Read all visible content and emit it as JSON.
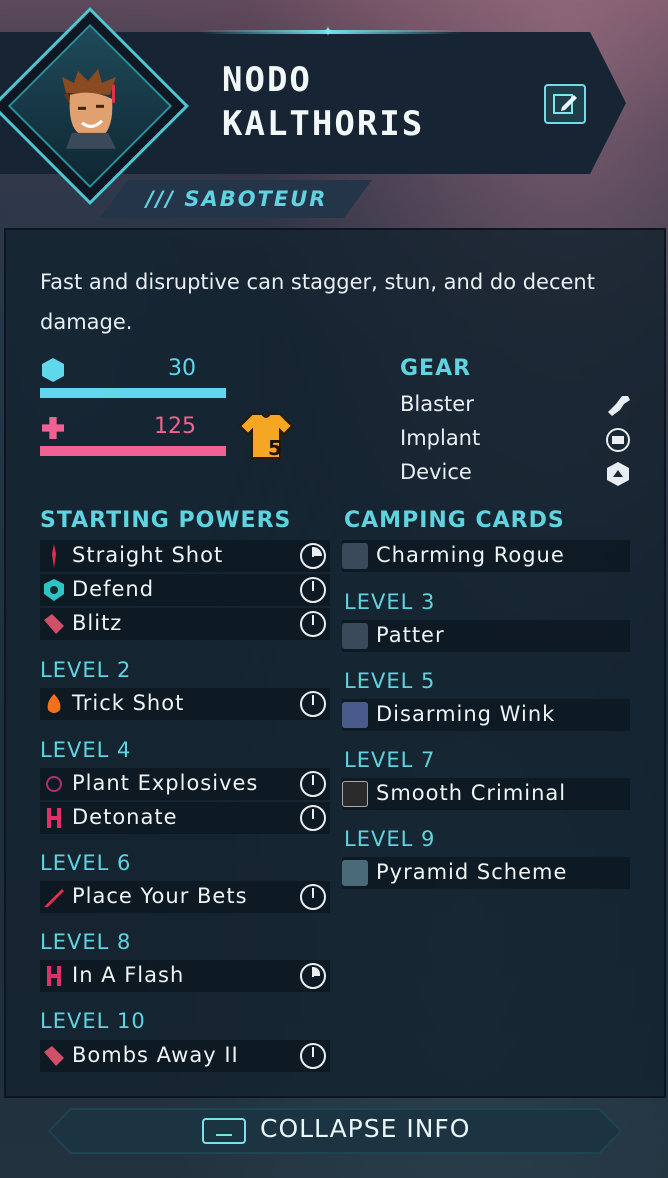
{
  "header": {
    "name_line1": "NODO",
    "name_line2": "KALTHORIS",
    "class": "/// SABOTEUR"
  },
  "description": "Fast and disruptive can stagger, stun, and do decent damage.",
  "stats": {
    "armor": "30",
    "health": "125",
    "badge_level": "5"
  },
  "gear": {
    "title": "GEAR",
    "items": [
      {
        "label": "Blaster",
        "icon": "blaster-icon"
      },
      {
        "label": "Implant",
        "icon": "implant-icon"
      },
      {
        "label": "Device",
        "icon": "device-icon"
      }
    ]
  },
  "powers": {
    "title": "STARTING POWERS",
    "starting": [
      {
        "label": "Straight Shot",
        "icon": "straight-shot-icon",
        "clock": "quarter"
      },
      {
        "label": "Defend",
        "icon": "defend-icon",
        "clock": "full"
      },
      {
        "label": "Blitz",
        "icon": "blitz-icon",
        "clock": "full"
      }
    ],
    "levels": [
      {
        "level": "LEVEL 2",
        "items": [
          {
            "label": "Trick Shot",
            "icon": "trick-shot-icon",
            "clock": "full"
          }
        ]
      },
      {
        "level": "LEVEL 4",
        "items": [
          {
            "label": "Plant Explosives",
            "icon": "plant-explosives-icon",
            "clock": "full"
          },
          {
            "label": "Detonate",
            "icon": "detonate-icon",
            "clock": "full"
          }
        ]
      },
      {
        "level": "LEVEL 6",
        "items": [
          {
            "label": "Place Your Bets",
            "icon": "place-your-bets-icon",
            "clock": "full"
          }
        ]
      },
      {
        "level": "LEVEL 8",
        "items": [
          {
            "label": "In A Flash",
            "icon": "in-a-flash-icon",
            "clock": "eighth"
          }
        ]
      },
      {
        "level": "LEVEL 10",
        "items": [
          {
            "label": "Bombs Away II",
            "icon": "bombs-away-icon",
            "clock": "full"
          }
        ]
      }
    ]
  },
  "camping": {
    "title": "CAMPING CARDS",
    "starting": [
      {
        "label": "Charming Rogue"
      }
    ],
    "levels": [
      {
        "level": "LEVEL 3",
        "label": "Patter"
      },
      {
        "level": "LEVEL 5",
        "label": "Disarming Wink"
      },
      {
        "level": "LEVEL 7",
        "label": "Smooth Criminal"
      },
      {
        "level": "LEVEL 9",
        "label": "Pyramid Scheme"
      }
    ]
  },
  "footer": {
    "collapse_label": "COLLAPSE INFO"
  },
  "colors": {
    "accent": "#5fd4e0",
    "armor": "#5fd8ec",
    "health": "#f06292",
    "badge": "#f5a623"
  }
}
